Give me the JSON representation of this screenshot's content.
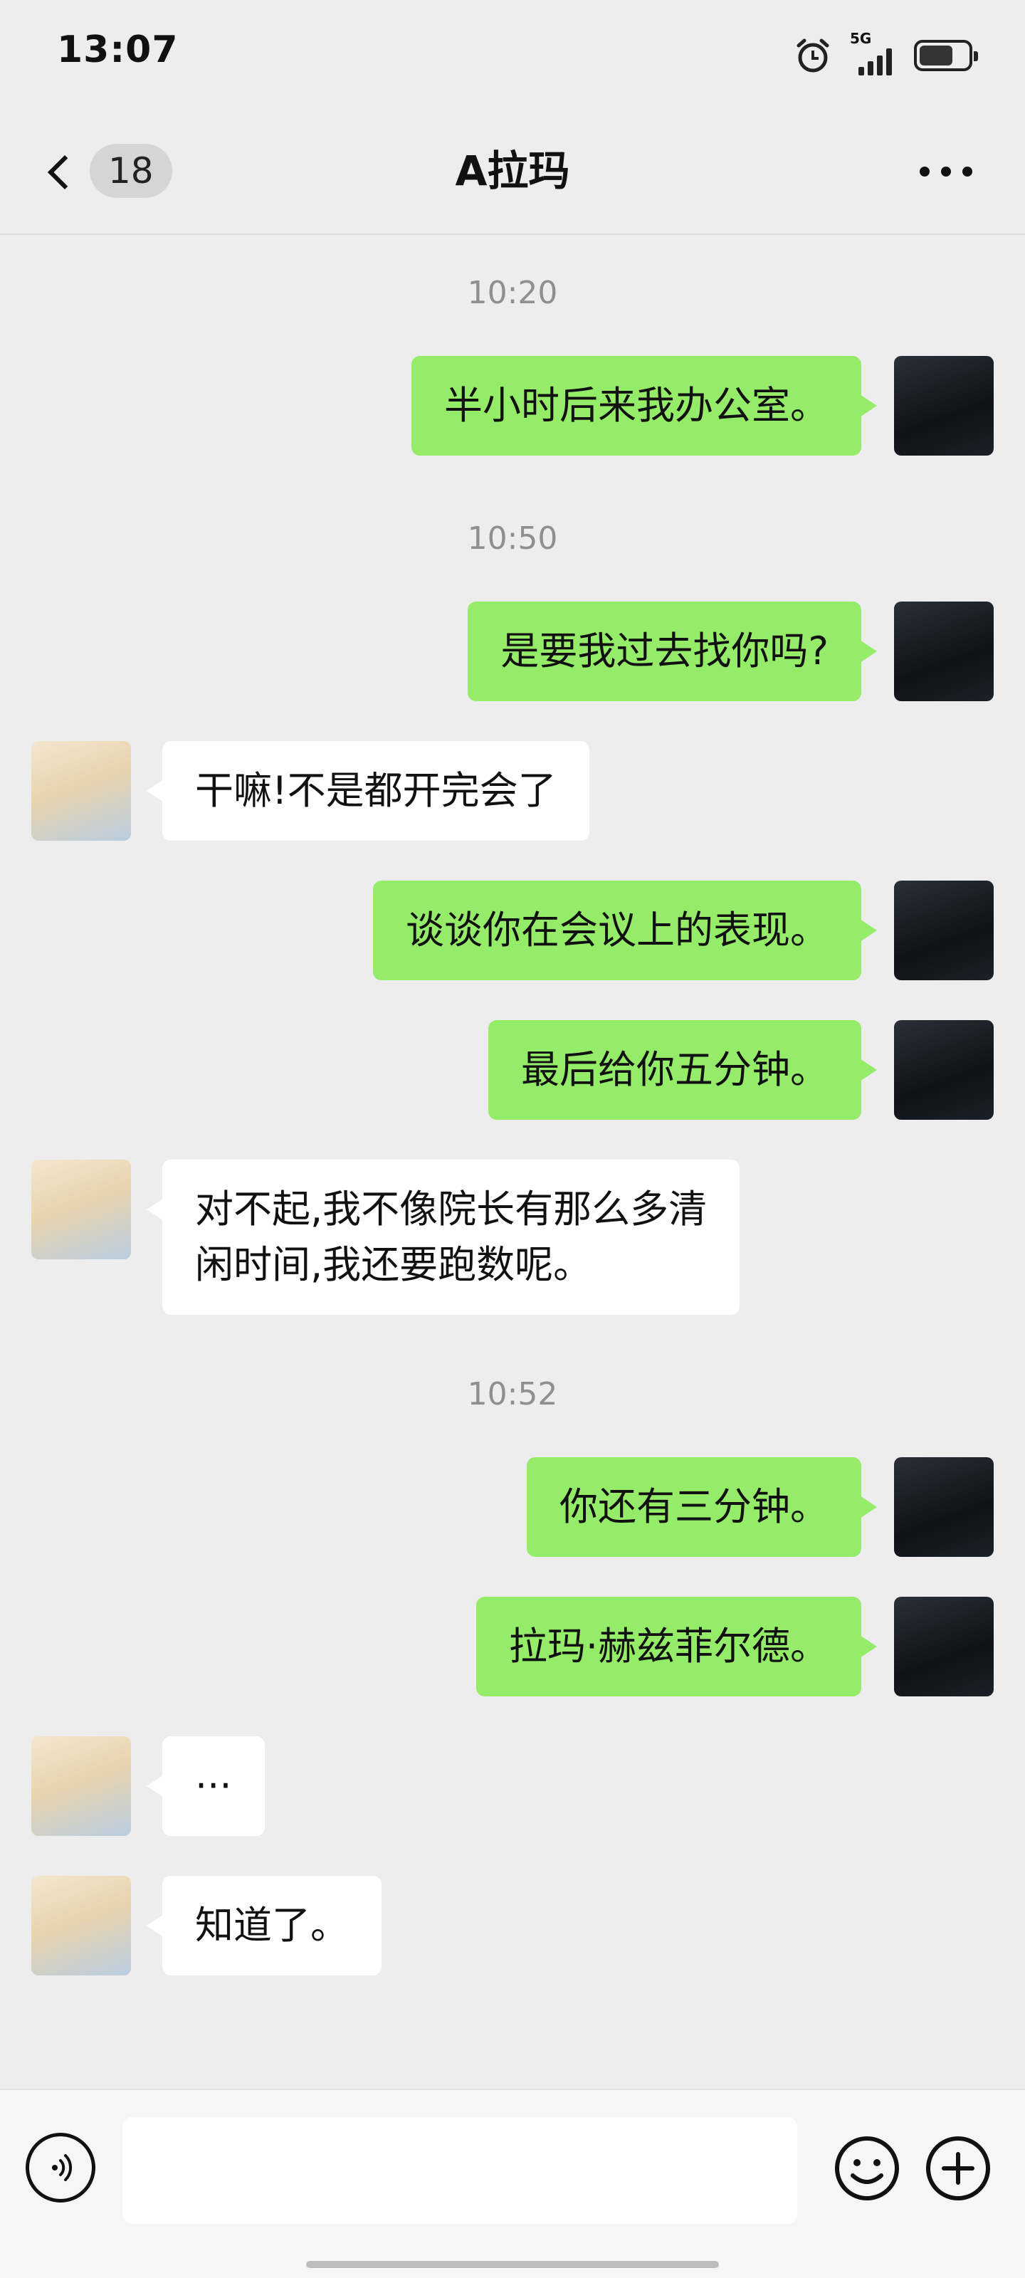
{
  "status_bar": {
    "time": "13:07",
    "network": "5G",
    "icons": [
      "alarm-icon",
      "signal-icon",
      "battery-icon"
    ],
    "battery_level": 0.7
  },
  "header": {
    "back_icon": "chevron-left-icon",
    "unread_count": "18",
    "title": "A拉玛",
    "more_icon": "more-icon"
  },
  "timestamps": [
    "10:20",
    "10:50",
    "10:52"
  ],
  "messages": [
    {
      "sender": "me",
      "text": "半小时后来我办公室。"
    },
    {
      "sender": "me",
      "text": "是要我过去找你吗?"
    },
    {
      "sender": "other",
      "text": "干嘛!不是都开完会了"
    },
    {
      "sender": "me",
      "text": "谈谈你在会议上的表现。"
    },
    {
      "sender": "me",
      "text": "最后给你五分钟。"
    },
    {
      "sender": "other",
      "text_line1": "对不起,我不像院长有那么多清",
      "text_line2": "闲时间,我还要跑数呢。"
    },
    {
      "sender": "me",
      "text": "你还有三分钟。"
    },
    {
      "sender": "me",
      "text": "拉玛·赫兹菲尔德。"
    },
    {
      "sender": "other",
      "text": "···"
    },
    {
      "sender": "other",
      "text": "知道了。"
    }
  ],
  "input_bar": {
    "voice_icon": "voice-icon",
    "input_value": "",
    "emoji_icon": "emoji-icon",
    "plus_icon": "plus-icon"
  },
  "colors": {
    "background": "#ededed",
    "my_bubble": "#95ec69",
    "their_bubble": "#ffffff",
    "timestamp": "#8f8f8f"
  }
}
